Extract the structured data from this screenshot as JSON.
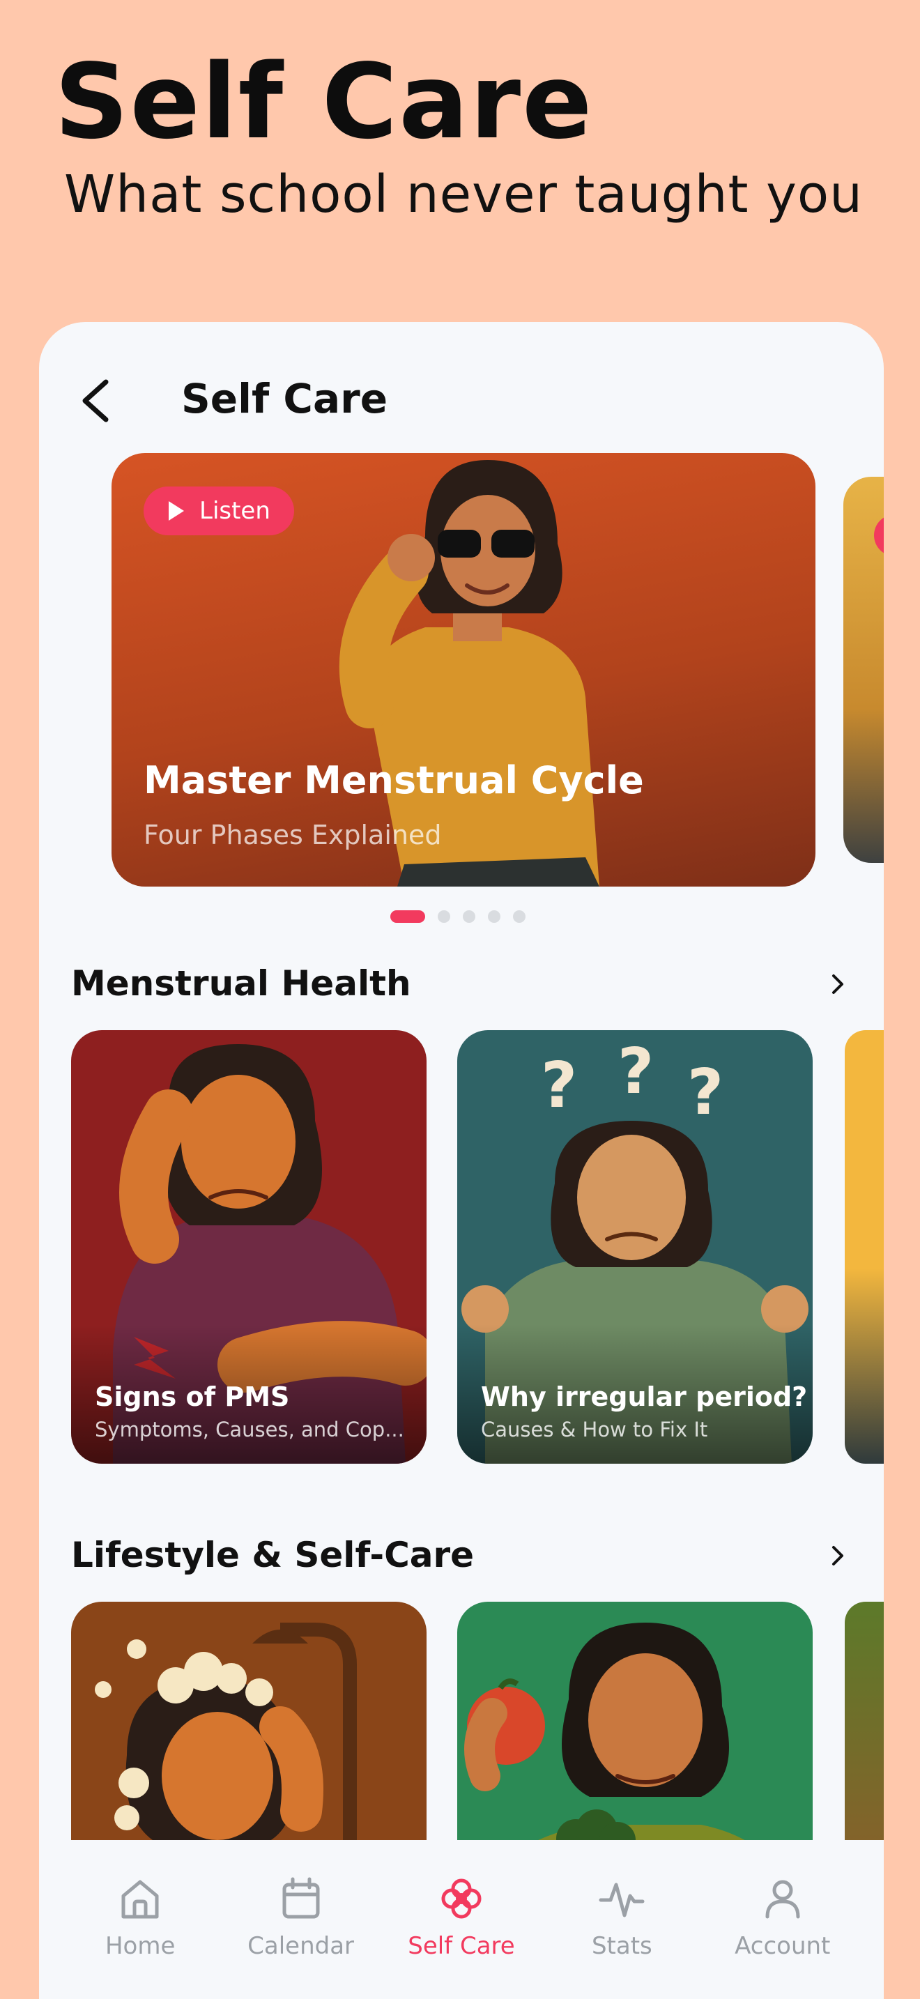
{
  "hero": {
    "title": "Self Care",
    "subtitle": "What school never taught you"
  },
  "screen": {
    "title": "Self Care",
    "back_icon": "chevron-left-icon"
  },
  "featured": {
    "listen_label": "Listen",
    "title": "Master Menstrual Cycle",
    "subtitle": "Four Phases Explained",
    "page_count": 5,
    "active_page": 1
  },
  "sections": [
    {
      "title": "Menstrual Health",
      "cards": [
        {
          "title": "Signs of PMS",
          "subtitle": "Symptoms, Causes, and Cop..."
        },
        {
          "title": "Why irregular period?",
          "subtitle": "Causes & How to Fix It"
        }
      ]
    },
    {
      "title": "Lifestyle & Self-Care",
      "cards": [
        {
          "title": "",
          "subtitle": ""
        },
        {
          "title": "",
          "subtitle": ""
        }
      ]
    }
  ],
  "tabs": [
    {
      "label": "Home",
      "icon": "home-icon",
      "active": false
    },
    {
      "label": "Calendar",
      "icon": "calendar-icon",
      "active": false
    },
    {
      "label": "Self Care",
      "icon": "flower-icon",
      "active": true
    },
    {
      "label": "Stats",
      "icon": "pulse-icon",
      "active": false
    },
    {
      "label": "Account",
      "icon": "person-icon",
      "active": false
    }
  ],
  "colors": {
    "background": "#FFC8AC",
    "accent": "#F23A5E",
    "card_surface": "#F6F8FB",
    "inactive_tab": "#9BA0A6"
  }
}
